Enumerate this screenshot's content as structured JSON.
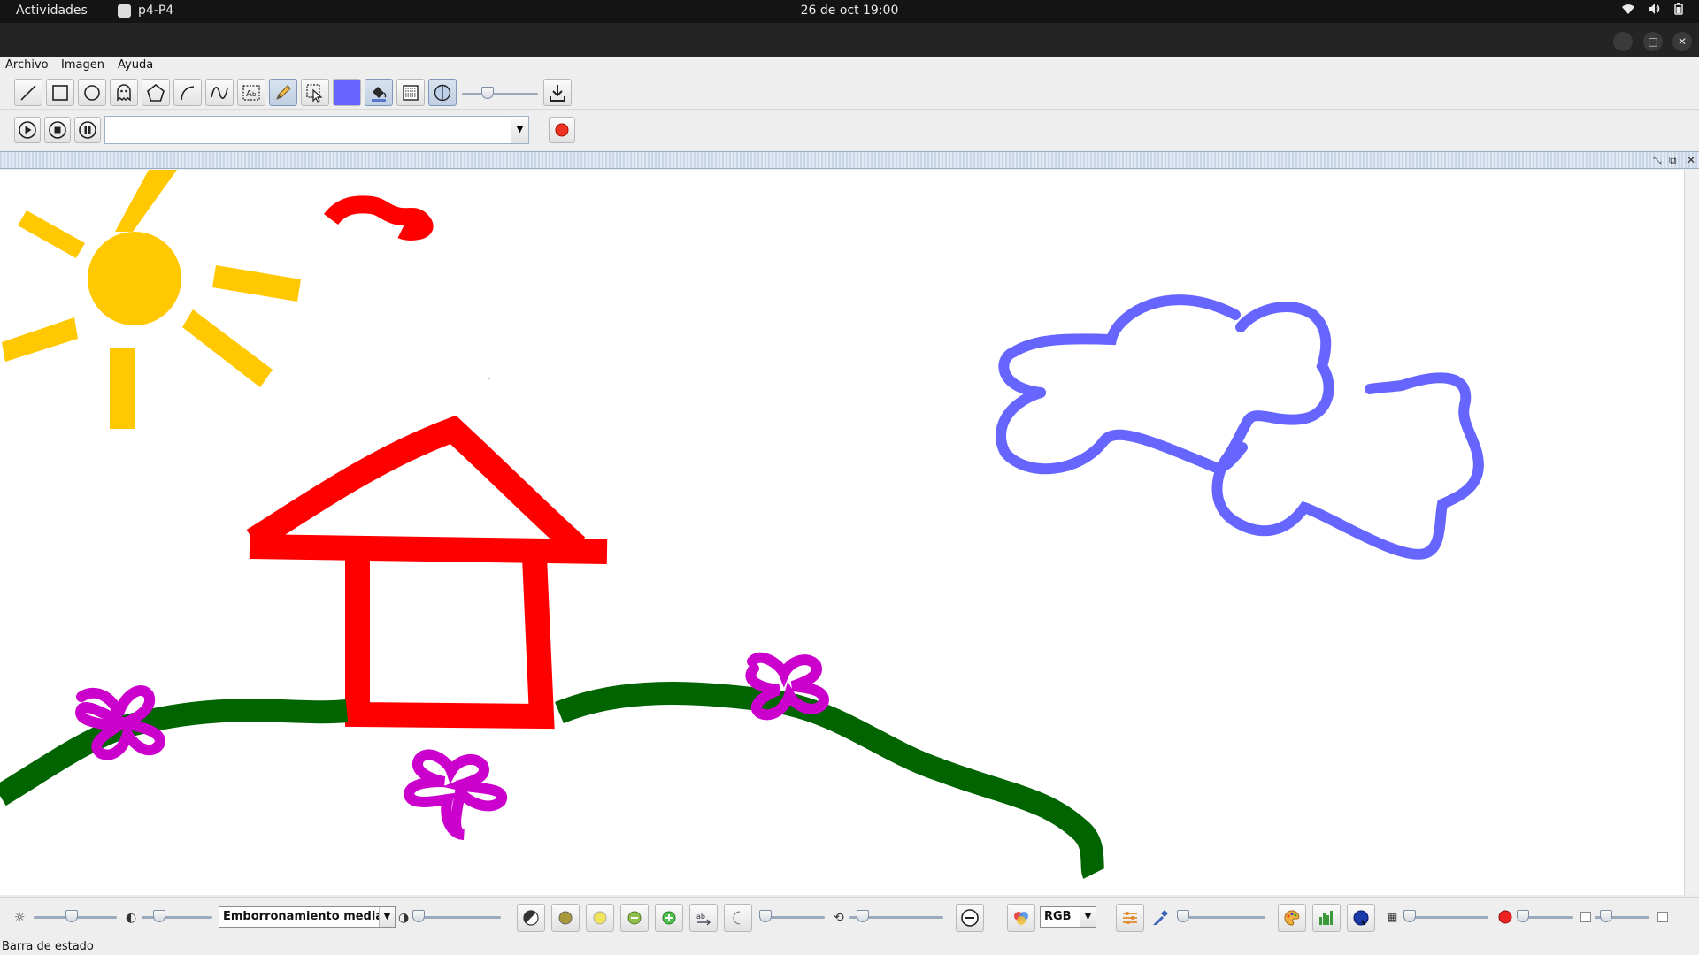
{
  "system": {
    "activities": "Actividades",
    "app_name": "p4-P4",
    "clock": "26 de oct  19:00",
    "tray_icons": [
      "wifi-icon",
      "volume-icon",
      "battery-icon"
    ]
  },
  "window": {
    "controls": [
      "minimize-icon",
      "maximize-icon",
      "close-icon"
    ],
    "minimize": "–",
    "maximize": "□",
    "close": "✕"
  },
  "menu": {
    "items": [
      "Archivo",
      "Imagen",
      "Ayuda"
    ]
  },
  "toolbar": {
    "tools": [
      "line",
      "rectangle",
      "ellipse",
      "ghost-shape",
      "polygon",
      "curve",
      "spline",
      "text",
      "pencil",
      "select",
      "color",
      "fill",
      "pattern",
      "transparency"
    ],
    "selected_tool": "pencil",
    "current_color": "#6666ff",
    "stroke_level": 0.3
  },
  "player": {
    "controls": [
      "play",
      "stop",
      "pause",
      "record"
    ],
    "combo_value": ""
  },
  "canvas": {
    "colors": {
      "sun": "#ffc800",
      "red": "#ff0000",
      "cloud": "#6666ff",
      "grass": "#006400",
      "flower": "#cc00cc"
    }
  },
  "filters": {
    "blur_option": "Emborronamiento media",
    "color_space": "RGB",
    "brightness_level": 0.45,
    "contrast_level": 0.2
  },
  "status": "Barra de estado"
}
